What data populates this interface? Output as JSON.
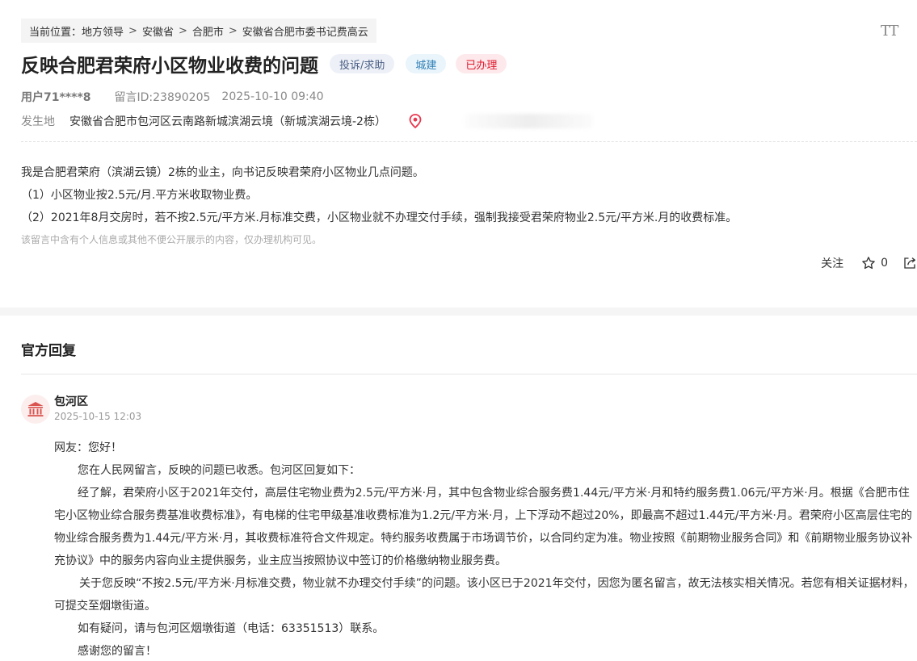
{
  "breadcrumb": {
    "prefix": "当前位置：",
    "items": [
      "地方领导",
      "安徽省",
      "合肥市",
      "安徽省合肥市委书记费高云"
    ],
    "separator": ">"
  },
  "font_toggle": "TT",
  "post": {
    "title": "反映合肥君荣府小区物业收费的问题",
    "tags": {
      "type": "投诉/求助",
      "field": "城建",
      "status": "已办理"
    },
    "user": "用户71****8",
    "message_id": "留言ID:23890205",
    "datetime": "2025-10-10 09:40",
    "location_label": "发生地",
    "location": "安徽省合肥市包河区云南路新城滨湖云境（新城滨湖云境-2栋）",
    "paragraphs": [
      "我是合肥君荣府（滨湖云镜）2栋的业主，向书记反映君荣府小区物业几点问题。",
      "（1）小区物业按2.5元/月.平方米收取物业费。",
      "（2）2021年8月交房时，若不按2.5元/平方米.月标准交费，小区物业就不办理交付手续，强制我接受君荣府物业2.5元/平方米.月的收费标准。"
    ],
    "privacy_notice": "该留言中含有个人信息或其他不便公开展示的内容，仅办理机构可见。"
  },
  "actions": {
    "follow": "关注",
    "favorite_count": "0"
  },
  "reply": {
    "section_title": "官方回复",
    "org": "包河区",
    "datetime": "2025-10-15 12:03",
    "greeting": "网友：您好！",
    "paragraphs": [
      "您在人民网留言，反映的问题已收悉。包河区回复如下：",
      "经了解，君荣府小区于2021年交付，高层住宅物业费为2.5元/平方米·月，其中包含物业综合服务费1.44元/平方米·月和特约服务费1.06元/平方米·月。根据《合肥市住宅小区物业综合服务费基准收费标准》，有电梯的住宅甲级基准收费标准为1.2元/平方米·月，上下浮动不超过20%，即最高不超过1.44元/平方米·月。君荣府小区高层住宅的物业综合服务费为1.44元/平方米·月，其收费标准符合文件规定。特约服务收费属于市场调节价，以合同约定为准。物业按照《前期物业服务合同》和《前期物业服务协议补充协议》中的服务内容向业主提供服务，业主应当按照协议中签订的价格缴纳物业服务费。",
      "关于您反映“不按2.5元/平方米·月标准交费，物业就不办理交付手续”的问题。该小区已于2021年交付，因您为匿名留言，故无法核实相关情况。若您有相关证据材料，可提交至烟墩街道。",
      "如有疑问，请与包河区烟墩街道（电话：63351513）联系。",
      "感谢您的留言！"
    ]
  },
  "colors": {
    "status_red": "#e0182d",
    "pin_red": "#e8384f",
    "avatar_red": "#d9534f"
  }
}
